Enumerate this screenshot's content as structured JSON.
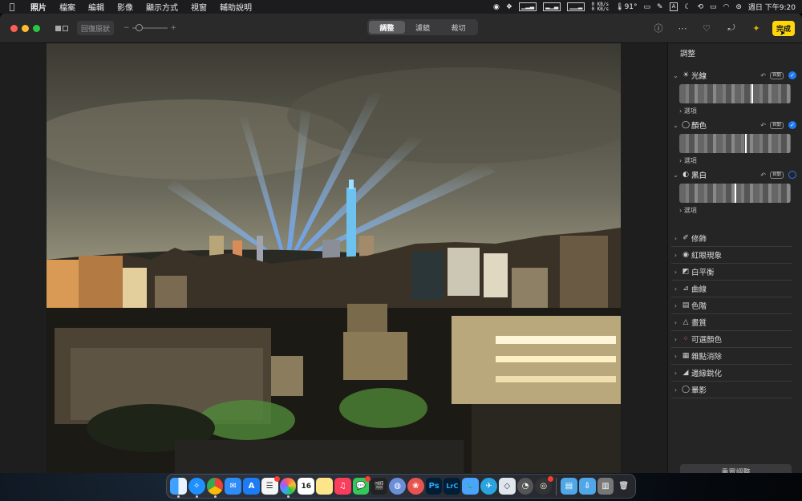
{
  "menubar": {
    "app_name": "照片",
    "menus": [
      "檔案",
      "編輯",
      "影像",
      "顯示方式",
      "視窗",
      "輔助說明"
    ],
    "net_up": "0 KB/s",
    "net_down": "0 KB/s",
    "temperature": "91°",
    "input_source": "A",
    "clock": "週日 下午9:20"
  },
  "toolbar": {
    "revert_label": "回復原狀",
    "zoom_minus": "−",
    "zoom_plus": "+",
    "tabs": [
      {
        "label": "調整",
        "active": true
      },
      {
        "label": "濾鏡",
        "active": false
      },
      {
        "label": "裁切",
        "active": false
      }
    ],
    "done_label": "完成"
  },
  "panel": {
    "title": "調整",
    "expanded": [
      {
        "label": "光線",
        "icon": "sun-icon",
        "auto": "自動",
        "enabled": true,
        "slider_position": 0.66,
        "options": "選項"
      },
      {
        "label": "顏色",
        "icon": "color-circle-icon",
        "auto": "自動",
        "enabled": true,
        "slider_position": 0.6,
        "options": "選項"
      },
      {
        "label": "黑白",
        "icon": "half-circle-icon",
        "auto": "自動",
        "enabled": false,
        "slider_position": 0.5,
        "options": "選項"
      }
    ],
    "collapsed": [
      {
        "label": "修飾",
        "icon": "bandage-icon"
      },
      {
        "label": "紅眼現象",
        "icon": "eye-icon"
      },
      {
        "label": "白平衡",
        "icon": "white-balance-icon"
      },
      {
        "label": "曲線",
        "icon": "curves-icon"
      },
      {
        "label": "色階",
        "icon": "levels-icon"
      },
      {
        "label": "畫質",
        "icon": "definition-icon"
      },
      {
        "label": "可選顏色",
        "icon": "selective-color-icon"
      },
      {
        "label": "雜點消除",
        "icon": "noise-reduction-icon"
      },
      {
        "label": "邊緣銳化",
        "icon": "sharpen-icon"
      },
      {
        "label": "暈影",
        "icon": "vignette-icon"
      }
    ],
    "reset_label": "重置調整"
  },
  "dock": {
    "calendar_day": "16",
    "apps": [
      "Finder",
      "Safari",
      "Chrome",
      "Mail",
      "App Store",
      "Reminders",
      "Photos",
      "Calendar",
      "Notes",
      "Music",
      "Messages",
      "Final Cut Pro",
      "Compressor",
      "Pixelmator",
      "Photoshop",
      "Lightroom Classic",
      "Tweetbot",
      "Telegram",
      "Network Radar",
      "Monitor",
      "Unity",
      "Activity",
      "Downloads",
      "Applications",
      "Preview",
      "Trash"
    ],
    "ps_label": "Ps",
    "lrc_label": "LrC"
  },
  "colors": {
    "accent": "#1e7bf2",
    "done": "#ffd60a",
    "window_bg": "#1e1e1e",
    "panel_bg": "#252526"
  }
}
